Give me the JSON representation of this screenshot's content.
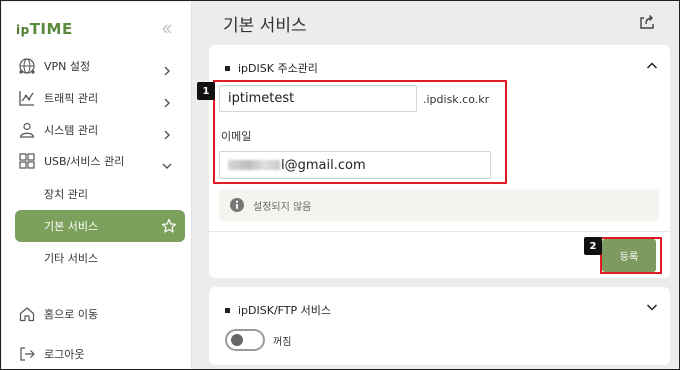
{
  "app": {
    "logo_prefix": "ip",
    "logo_main": "TIME"
  },
  "sidebar": {
    "items": [
      {
        "label": "VPN 설정",
        "icon": "globe-network-icon"
      },
      {
        "label": "트래픽 관리",
        "icon": "chart-icon"
      },
      {
        "label": "시스템 관리",
        "icon": "user-gear-icon"
      },
      {
        "label": "USB/서비스 관리",
        "icon": "grid-icon"
      }
    ],
    "sub_items": [
      {
        "label": "장치 관리"
      },
      {
        "label": "기본 서비스",
        "active": true
      },
      {
        "label": "기타 서비스"
      }
    ],
    "footer": [
      {
        "label": "홈으로 이동",
        "icon": "home-icon"
      },
      {
        "label": "로그아웃",
        "icon": "logout-icon"
      }
    ]
  },
  "main": {
    "title": "기본 서비스"
  },
  "ipdisk": {
    "section_title": "ipDISK 주소관리",
    "hostname_value": "iptimetest",
    "domain_suffix": ".ipdisk.co.kr",
    "email_label": "이메일",
    "email_visible": "l@gmail.com",
    "status_text": "설정되지 않음",
    "register_label": "등록"
  },
  "ftp": {
    "section_title": "ipDISK/FTP 서비스",
    "toggle_label": "꺼짐"
  },
  "annotations": {
    "marker1": "1",
    "marker2": "2"
  },
  "colors": {
    "accent": "#7ba05c",
    "button": "#7d9a61",
    "highlight": "#e01b24"
  }
}
